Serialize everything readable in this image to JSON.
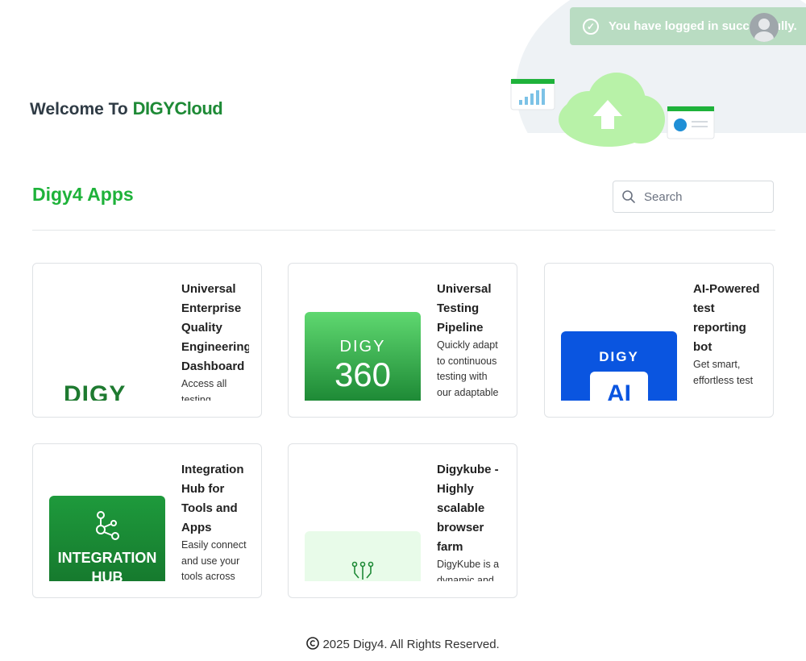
{
  "header": {
    "welcome_prefix": "Welcome To",
    "brand": "DIGYCloud"
  },
  "toast": {
    "message": "You have logged in successfully.",
    "icon": "check-circle-icon",
    "color": "#b9dcc2"
  },
  "section": {
    "title": "Digy4 Apps",
    "search_placeholder": "Search"
  },
  "apps": [
    {
      "title": "Universal Enterprise Quality Engineering Dashboard",
      "description": "Access all testing",
      "thumb_text": "DIGY"
    },
    {
      "title": "Universal Testing Pipeline",
      "description": "Quickly adapt to continuous testing with our adaptable",
      "thumb_label": "DIGY",
      "thumb_number": "360"
    },
    {
      "title": "AI-Powered test reporting bot",
      "description": "Get smart, effortless test",
      "thumb_label": "DIGY",
      "thumb_sub": "AI"
    },
    {
      "title": "Integration Hub for Tools and Apps",
      "description": "Easily connect and use your tools across",
      "thumb_text": "INTEGRATION HUB"
    },
    {
      "title": "Digykube - Highly scalable browser farm",
      "description": "DigyKube is a dynamic and"
    }
  ],
  "footer": {
    "copyright": "2025 Digy4. All Rights Reserved."
  },
  "colors": {
    "brand_green": "#1e8a36",
    "accent_green": "#1eb23a",
    "blue": "#0a55e0"
  }
}
